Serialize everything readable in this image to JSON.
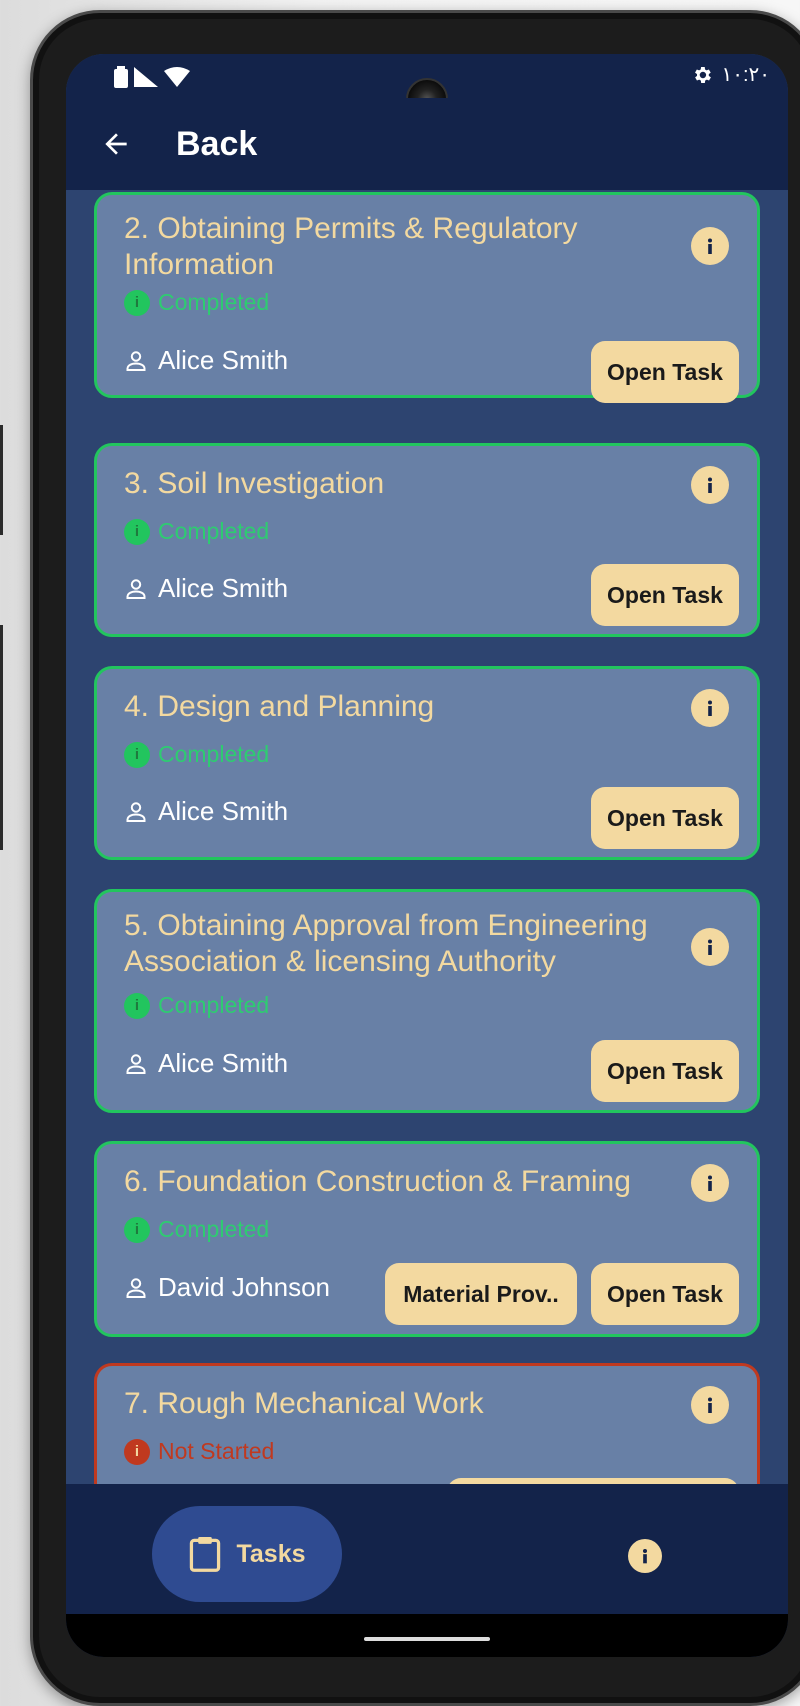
{
  "statusbar": {
    "time": "١٠:٢٠"
  },
  "appbar": {
    "back_label": "Back"
  },
  "tasks": [
    {
      "title": "2. Obtaining Permits & Regulatory Information",
      "status": "Completed",
      "assignee": "Alice Smith",
      "actions": [
        "Open Task"
      ]
    },
    {
      "title": "3. Soil Investigation",
      "status": "Completed",
      "assignee": "Alice Smith",
      "actions": [
        "Open Task"
      ]
    },
    {
      "title": "4. Design and Planning",
      "status": "Completed",
      "assignee": "Alice Smith",
      "actions": [
        "Open Task"
      ]
    },
    {
      "title": "5. Obtaining Approval from Engineering Association & licensing Authority",
      "status": "Completed",
      "assignee": "Alice Smith",
      "actions": [
        "Open Task"
      ]
    },
    {
      "title": "6. Foundation Construction & Framing",
      "status": "Completed",
      "assignee": "David Johnson",
      "actions": [
        "Material Prov..",
        "Open Task"
      ]
    },
    {
      "title": "7. Rough Mechanical Work",
      "status": "Not Started"
    }
  ],
  "bottom_nav": {
    "tasks_label": "Tasks"
  },
  "colors": {
    "accent": "#f3d9a0",
    "completed": "#22c55e",
    "not_started": "#c0391f",
    "card": "#6880a6",
    "background": "#2d4470",
    "bar": "#13234a"
  }
}
